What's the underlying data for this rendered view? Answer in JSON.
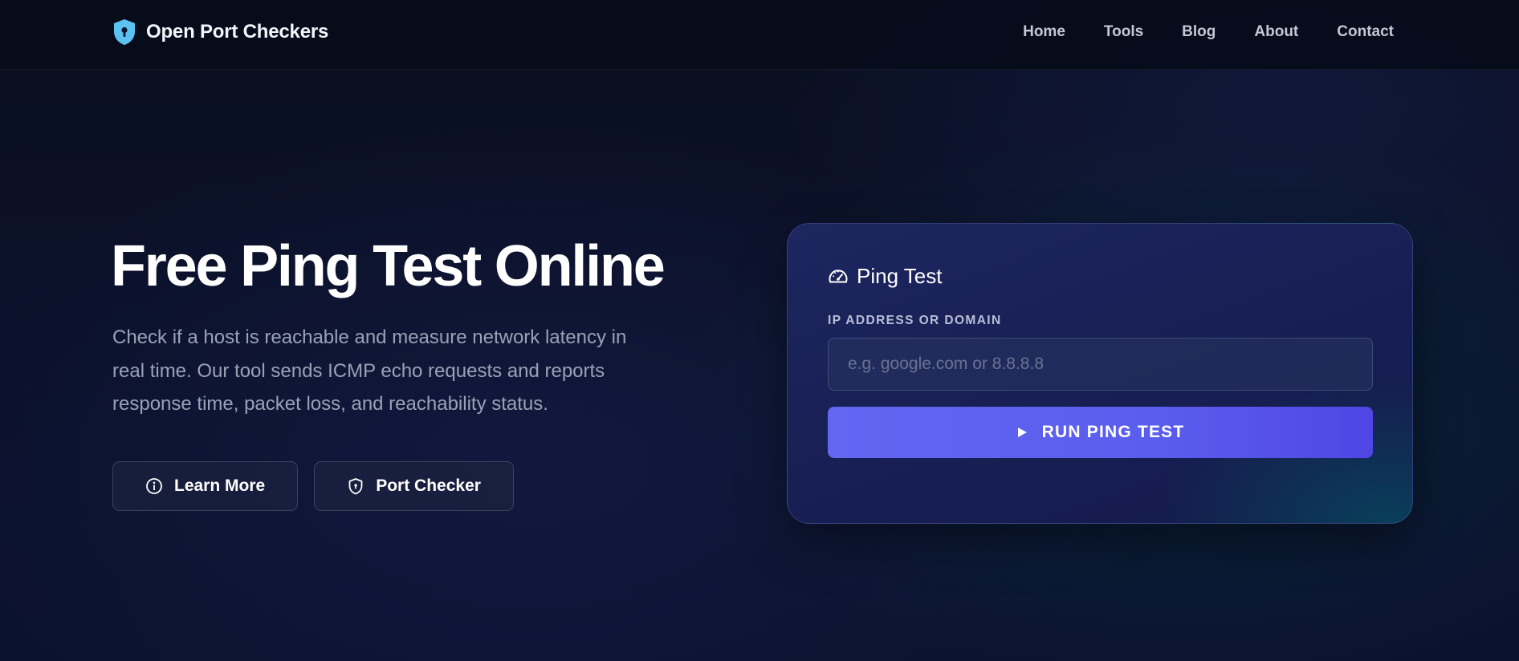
{
  "brand": {
    "name": "Open Port Checkers",
    "icon": "shield-keyhole-icon",
    "accent": "#38bdf8"
  },
  "nav": {
    "items": [
      {
        "label": "Home"
      },
      {
        "label": "Tools"
      },
      {
        "label": "Blog"
      },
      {
        "label": "About"
      },
      {
        "label": "Contact"
      }
    ]
  },
  "hero": {
    "title": "Free Ping Test Online",
    "description": "Check if a host is reachable and measure network latency in real time. Our tool sends ICMP echo requests and reports response time, packet loss, and reachability status.",
    "buttons": {
      "learn_more": {
        "label": "Learn More",
        "icon": "info-circle-icon"
      },
      "port_checker": {
        "label": "Port Checker",
        "icon": "shield-icon"
      }
    }
  },
  "ping_card": {
    "title": "Ping Test",
    "icon": "speedometer-icon",
    "field_label": "IP ADDRESS OR DOMAIN",
    "input_value": "",
    "input_placeholder": "e.g. google.com or 8.8.8.8",
    "run_button": {
      "label": "RUN PING TEST",
      "icon": "play-icon"
    }
  },
  "colors": {
    "background": "#0b1128",
    "card": "#1a215a",
    "primary_button": "#5b5ef0",
    "muted_text": "#9aa2b6"
  }
}
